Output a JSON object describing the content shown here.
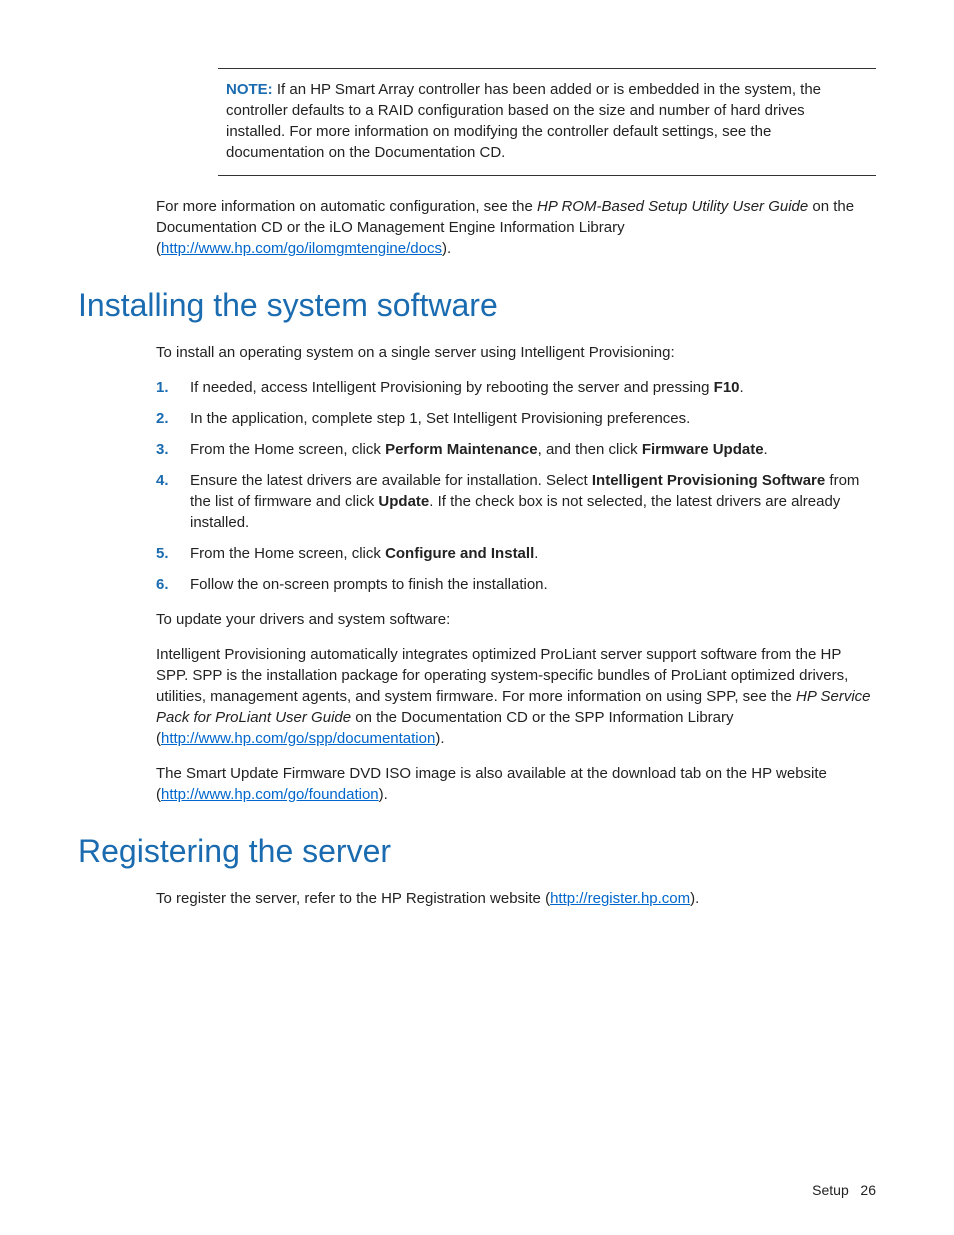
{
  "note": {
    "label": "NOTE:",
    "text": "If an HP Smart Array controller has been added or is embedded in the system, the controller defaults to a RAID configuration based on the size and number of hard drives installed. For more information on modifying the controller default settings, see the documentation on the Documentation CD."
  },
  "autoConfig": {
    "pre": "For more information on automatic configuration, see the ",
    "italic": "HP ROM-Based Setup Utility User Guide",
    "mid": " on the Documentation CD or the iLO Management Engine Information Library (",
    "link": "http://www.hp.com/go/ilomgmtengine/docs",
    "post": ")."
  },
  "section1": {
    "heading": "Installing the system software",
    "intro": "To install an operating system on a single server using Intelligent Provisioning:",
    "steps": [
      {
        "n": "1.",
        "parts": [
          {
            "t": "If needed, access Intelligent Provisioning by rebooting the server and pressing "
          },
          {
            "t": "F10",
            "b": true
          },
          {
            "t": "."
          }
        ]
      },
      {
        "n": "2.",
        "parts": [
          {
            "t": "In the application, complete step 1, Set Intelligent Provisioning preferences."
          }
        ]
      },
      {
        "n": "3.",
        "parts": [
          {
            "t": "From the Home screen, click "
          },
          {
            "t": "Perform Maintenance",
            "b": true
          },
          {
            "t": ", and then click "
          },
          {
            "t": "Firmware Update",
            "b": true
          },
          {
            "t": "."
          }
        ]
      },
      {
        "n": "4.",
        "parts": [
          {
            "t": "Ensure the latest drivers are available for installation. Select "
          },
          {
            "t": "Intelligent Provisioning Software",
            "b": true
          },
          {
            "t": " from the list of firmware and click "
          },
          {
            "t": "Update",
            "b": true
          },
          {
            "t": ". If the check box is not selected, the latest drivers are already installed."
          }
        ]
      },
      {
        "n": "5.",
        "parts": [
          {
            "t": "From the Home screen, click "
          },
          {
            "t": "Configure and Install",
            "b": true
          },
          {
            "t": "."
          }
        ]
      },
      {
        "n": "6.",
        "parts": [
          {
            "t": "Follow the on-screen prompts to finish the installation."
          }
        ]
      }
    ],
    "updateIntro": "To update your drivers and system software:",
    "spp": {
      "pre": "Intelligent Provisioning automatically integrates optimized ProLiant server support software from the HP SPP. SPP is the installation package for operating system-specific bundles of ProLiant optimized drivers, utilities, management agents, and system firmware. For more information on using SPP, see the ",
      "italic": "HP Service Pack for ProLiant User Guide",
      "mid": " on the Documentation CD or the SPP Information Library (",
      "link": "http://www.hp.com/go/spp/documentation",
      "post": ")."
    },
    "dvd": {
      "pre": "The Smart Update Firmware DVD ISO image is also available at the download tab on the HP website (",
      "link": "http://www.hp.com/go/foundation",
      "post": ")."
    }
  },
  "section2": {
    "heading": "Registering the server",
    "body": {
      "pre": "To register the server, refer to the HP Registration website (",
      "link": "http://register.hp.com",
      "post": ")."
    }
  },
  "footer": {
    "section": "Setup",
    "page": "26"
  }
}
